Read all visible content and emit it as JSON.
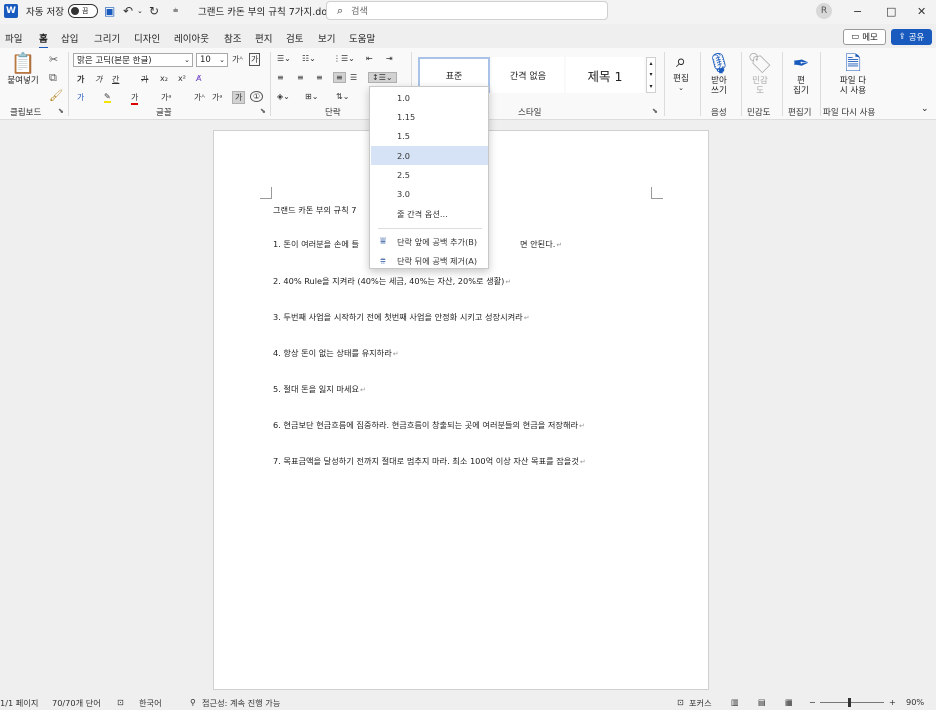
{
  "titlebar": {
    "logo_letter": "W",
    "autosave_label": "자동 저장",
    "autosave_state": "끔",
    "doc_title": "그랜드 카돈 부의 규칙 7가지.docx",
    "search_placeholder": "검색",
    "profile_initial": "R",
    "minimize": "−",
    "maximize": "□",
    "close": "✕"
  },
  "menu": {
    "tabs": [
      "파일",
      "홈",
      "삽입",
      "그리기",
      "디자인",
      "레이아웃",
      "참조",
      "편지",
      "검토",
      "보기",
      "도움말"
    ],
    "active": "홈",
    "memo_label": "메모",
    "share_label": "공유"
  },
  "ribbon": {
    "clipboard": {
      "paste_label": "붙여넣기",
      "group_label": "클립보드"
    },
    "font": {
      "font_name": "맑은 고딕(본문 한글)",
      "font_size": "10",
      "group_label": "글꼴"
    },
    "paragraph": {
      "group_label": "단락"
    },
    "styles": {
      "items": [
        "표준",
        "간격 없음",
        "제목 1"
      ],
      "group_label": "스타일"
    },
    "editing": {
      "label": "편집"
    },
    "voice": {
      "dictate_label": "받아\n쓰기",
      "group_label": "음성"
    },
    "sensitivity": {
      "label": "민감\n도",
      "group_label": "민감도"
    },
    "editor": {
      "label": "편\n집기",
      "group_label": "편집기"
    },
    "reuse": {
      "label": "파일 다\n시 사용",
      "group_label": "파일 다시 사용"
    }
  },
  "spacing_menu": {
    "options": [
      "1.0",
      "1.15",
      "1.5",
      "2.0",
      "2.5",
      "3.0"
    ],
    "selected": "2.0",
    "line_options_label": "줄 간격 옵션...",
    "add_before_label": "단락 앞에 공백 추가(B)",
    "remove_after_label": "단락 뒤에 공백 제거(A)"
  },
  "document": {
    "lines": [
      "그랜드 카돈 부의 규칙 7",
      "1. 돈이 여러분을 손에 들",
      "2. 40% Rule을 지켜라 (40%는 세금, 40%는 자산, 20%로 생활)",
      "3. 두번째 사업을 시작하기 전에 첫번째 사업을 안정화 시키고 성장시켜라",
      "4. 항상 돈이 없는 상태를 유지하라",
      "5. 절대 돈을 잃지 마세요",
      "6. 현금보단 현금흐름에 집중하라. 현금흐름이 창출되는 곳에 여러분들의 현금을 저장해라",
      "7. 목표금액을 달성하기 전까지 절대로 멈추지 마라. 최소 100억 이상 자산 목표를 잡을것"
    ],
    "line1_tail": "면 안된다."
  },
  "statusbar": {
    "page": "1/1 페이지",
    "words": "70/70개 단어",
    "language": "한국어",
    "accessibility": "접근성: 계속 진행 가능",
    "focus": "포커스",
    "zoom": "90%",
    "zoom_level": 0.9
  },
  "colors": {
    "accent": "#185abd",
    "selected_option": "#d6e2f5"
  }
}
